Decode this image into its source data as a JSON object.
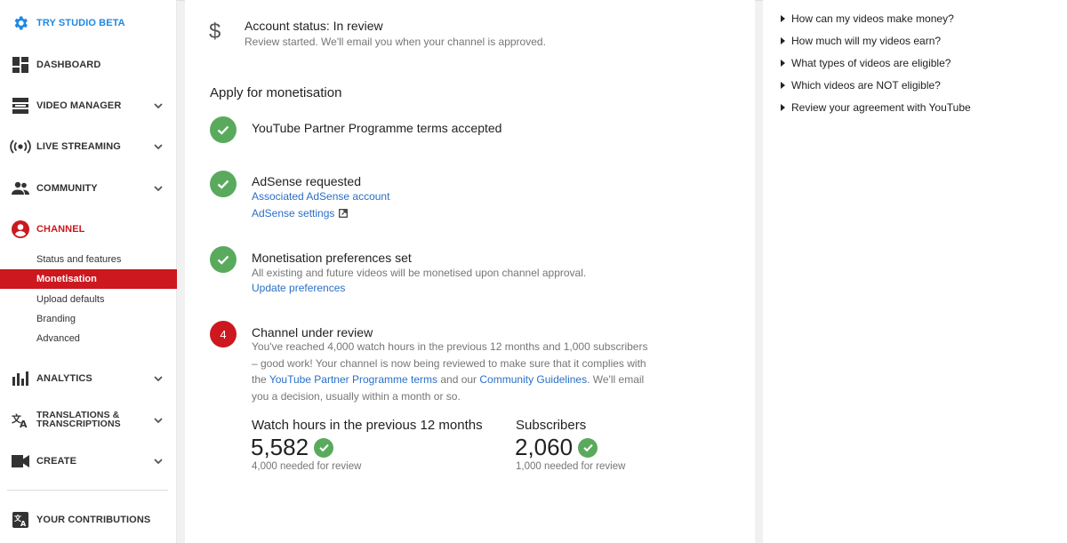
{
  "sidebar": {
    "studio_beta": "TRY STUDIO BETA",
    "dashboard": "DASHBOARD",
    "video_manager": "VIDEO MANAGER",
    "live_streaming": "LIVE STREAMING",
    "community": "COMMUNITY",
    "channel": "CHANNEL",
    "channel_sub": [
      "Status and features",
      "Monetisation",
      "Upload defaults",
      "Branding",
      "Advanced"
    ],
    "analytics": "ANALYTICS",
    "translations_1": "TRANSLATIONS &",
    "translations_2": "TRANSCRIPTIONS",
    "create": "CREATE",
    "your_contributions": "YOUR CONTRIBUTIONS"
  },
  "account": {
    "status": "Account status: In review",
    "detail": "Review started. We'll email you when your channel is approved."
  },
  "apply": {
    "heading": "Apply for monetisation",
    "step1": "YouTube Partner Programme terms accepted",
    "step2_title": "AdSense requested",
    "step2_link1": "Associated AdSense account",
    "step2_link2": "AdSense settings",
    "step3_title": "Monetisation preferences set",
    "step3_desc": "All existing and future videos will be monetised upon channel approval.",
    "step3_link": "Update preferences",
    "step4_number": "4",
    "step4_title": "Channel under review",
    "step4_body_1": "You've reached 4,000 watch hours in the previous 12 months and 1,000 subscribers – good work! Your channel is now being reviewed to make sure that it complies with the ",
    "step4_link_1": "YouTube Partner Programme terms",
    "step4_body_2": " and our ",
    "step4_link_2": "Community Guidelines",
    "step4_body_3": ". We'll email you a decision, usually within a month or so."
  },
  "stats": {
    "watch_title": "Watch hours in the previous 12 months",
    "watch_value": "5,582",
    "watch_sub": "4,000 needed for review",
    "subs_title": "Subscribers",
    "subs_value": "2,060",
    "subs_sub": "1,000 needed for review"
  },
  "help": [
    "How can my videos make money?",
    "How much will my videos earn?",
    "What types of videos are eligible?",
    "Which videos are NOT eligible?",
    "Review your agreement with YouTube"
  ],
  "colors": {
    "accent_red": "#cc181e",
    "link_blue": "#2a6fc7",
    "success_green": "#5aaa5e",
    "studio_blue": "#1e88e5"
  }
}
